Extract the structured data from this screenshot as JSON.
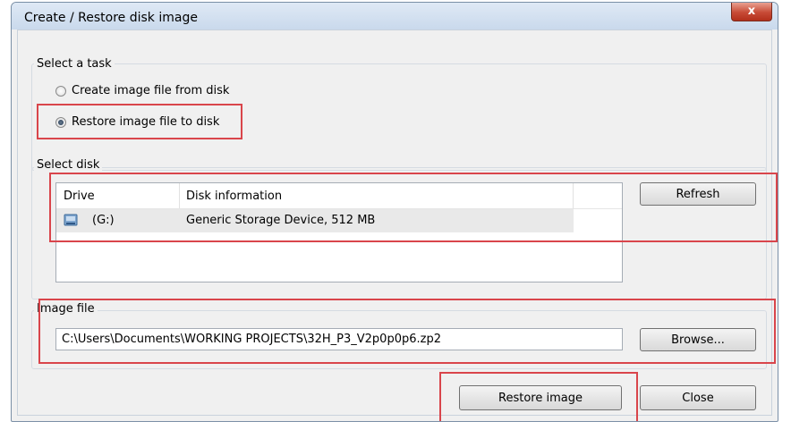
{
  "window": {
    "title": "Create / Restore disk image",
    "close_glyph": "x"
  },
  "task": {
    "legend": "Select a task",
    "options": [
      {
        "label": "Create image file from disk",
        "selected": false
      },
      {
        "label": "Restore image file to disk",
        "selected": true
      }
    ]
  },
  "disk": {
    "legend": "Select disk",
    "columns": [
      "Drive",
      "Disk information"
    ],
    "rows": [
      {
        "icon": "usb-drive-icon",
        "drive": "(G:)",
        "info": "Generic Storage Device, 512 MB"
      }
    ],
    "refresh_label": "Refresh"
  },
  "image": {
    "legend": "Image file",
    "path": "C:\\Users\\Documents\\WORKING PROJECTS\\32H_P3_V2p0p0p6.zp2",
    "browse_label": "Browse..."
  },
  "footer": {
    "restore_label": "Restore image",
    "close_label": "Close"
  },
  "colors": {
    "highlight": "#d9454b",
    "titlebar": "#c9d9ec"
  }
}
